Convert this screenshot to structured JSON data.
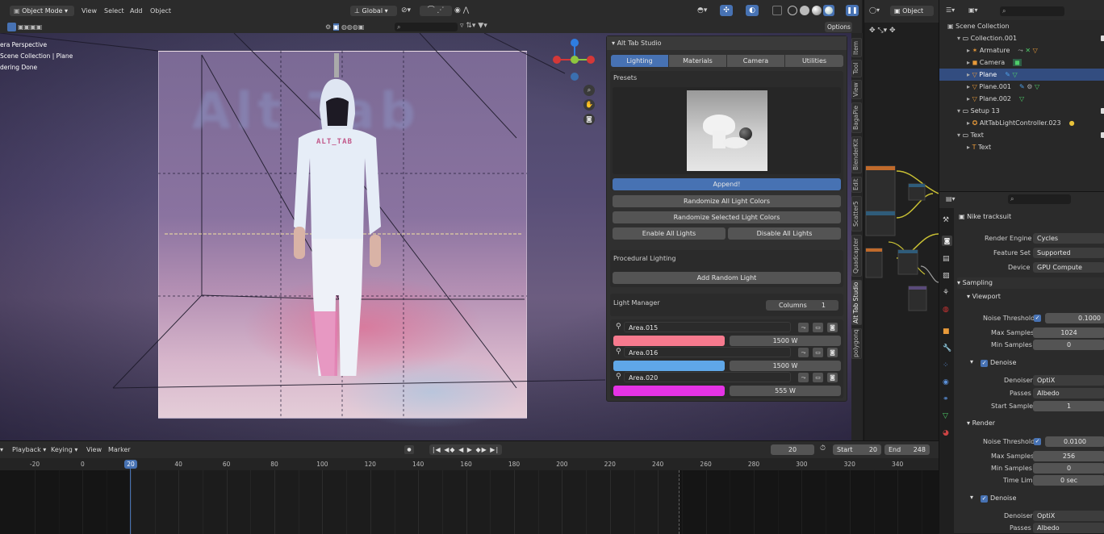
{
  "topbar": {
    "mode": "Object Mode",
    "menus": [
      "View",
      "Select",
      "Add",
      "Object"
    ],
    "orientation": "Global",
    "options": "Options",
    "object_menu": "Object"
  },
  "viewport": {
    "overlay_lines": [
      "era Perspective",
      "Scene Collection | Plane",
      "dering Done"
    ],
    "bg_text": "Alt Tab",
    "shirt_text": "ALT_TAB"
  },
  "sidebar_tabs": [
    "Item",
    "Tool",
    "View",
    "BagaPie",
    "BlenderKit",
    "Edit",
    "Scatter5",
    "Quadcapter",
    "Alt Tab Studio",
    "polygonq"
  ],
  "alt_tab_panel": {
    "title": "Alt Tab Studio",
    "tabs": [
      "Lighting",
      "Materials",
      "Camera",
      "Utilities"
    ],
    "presets_label": "Presets",
    "append_button": "Append!",
    "randomize_all": "Randomize All Light Colors",
    "randomize_selected": "Randomize Selected Light Colors",
    "enable_all": "Enable All Lights",
    "disable_all": "Disable All Lights",
    "procedural_label": "Procedural Lighting",
    "add_random_light": "Add Random Light",
    "light_manager_label": "Light Manager",
    "columns_label": "Columns",
    "columns_value": "1",
    "lights": [
      {
        "name": "Area.015",
        "color": "#f77a8e",
        "power": "1500 W"
      },
      {
        "name": "Area.016",
        "color": "#5fa7e8",
        "power": "1500 W"
      },
      {
        "name": "Area.020",
        "color": "#e533e5",
        "power": "555 W"
      }
    ]
  },
  "node_editor": {
    "mode": "Object"
  },
  "outliner": {
    "rows": [
      {
        "label": "Scene Collection",
        "depth": 0,
        "kind": "scene"
      },
      {
        "label": "Collection.001",
        "depth": 1,
        "kind": "collection"
      },
      {
        "label": "Armature",
        "depth": 2,
        "kind": "armature"
      },
      {
        "label": "Camera",
        "depth": 2,
        "kind": "camera"
      },
      {
        "label": "Plane",
        "depth": 2,
        "kind": "mesh",
        "selected": true
      },
      {
        "label": "Plane.001",
        "depth": 2,
        "kind": "mesh"
      },
      {
        "label": "Plane.002",
        "depth": 2,
        "kind": "mesh"
      },
      {
        "label": "Setup 13",
        "depth": 1,
        "kind": "collection"
      },
      {
        "label": "AltTabLightController.023",
        "depth": 2,
        "kind": "light"
      },
      {
        "label": "Text",
        "depth": 1,
        "kind": "collection"
      },
      {
        "label": "Text",
        "depth": 2,
        "kind": "text"
      }
    ]
  },
  "properties": {
    "scene_name": "Nike tracksuit",
    "render_engine_label": "Render Engine",
    "render_engine": "Cycles",
    "feature_set_label": "Feature Set",
    "feature_set": "Supported",
    "device_label": "Device",
    "device": "GPU Compute",
    "sampling": "Sampling",
    "viewport": "Viewport",
    "noise_threshold_label": "Noise Threshold",
    "vp_noise_threshold": "0.1000",
    "max_samples_label": "Max Samples",
    "vp_max_samples": "1024",
    "min_samples_label": "Min Samples",
    "vp_min_samples": "0",
    "denoise": "Denoise",
    "denoiser_label": "Denoiser",
    "vp_denoiser": "OptiX",
    "passes_label": "Passes",
    "vp_passes": "Albedo",
    "start_sample_label": "Start Sample",
    "vp_start_sample": "1",
    "render": "Render",
    "r_noise_threshold": "0.0100",
    "r_max_samples": "256",
    "r_min_samples": "0",
    "time_limit_label": "Time Limit",
    "r_time_limit": "0 sec",
    "r_denoiser": "OptiX",
    "r_passes": "Albedo"
  },
  "timeline": {
    "menus": [
      "Playback",
      "Keying",
      "View",
      "Marker"
    ],
    "current_frame": "20",
    "start_label": "Start",
    "start": "20",
    "end_label": "End",
    "end": "248",
    "ruler": [
      "-20",
      "0",
      "20",
      "40",
      "60",
      "80",
      "100",
      "120",
      "140",
      "160",
      "180",
      "200",
      "220",
      "240",
      "260",
      "280",
      "300",
      "320",
      "340"
    ]
  }
}
